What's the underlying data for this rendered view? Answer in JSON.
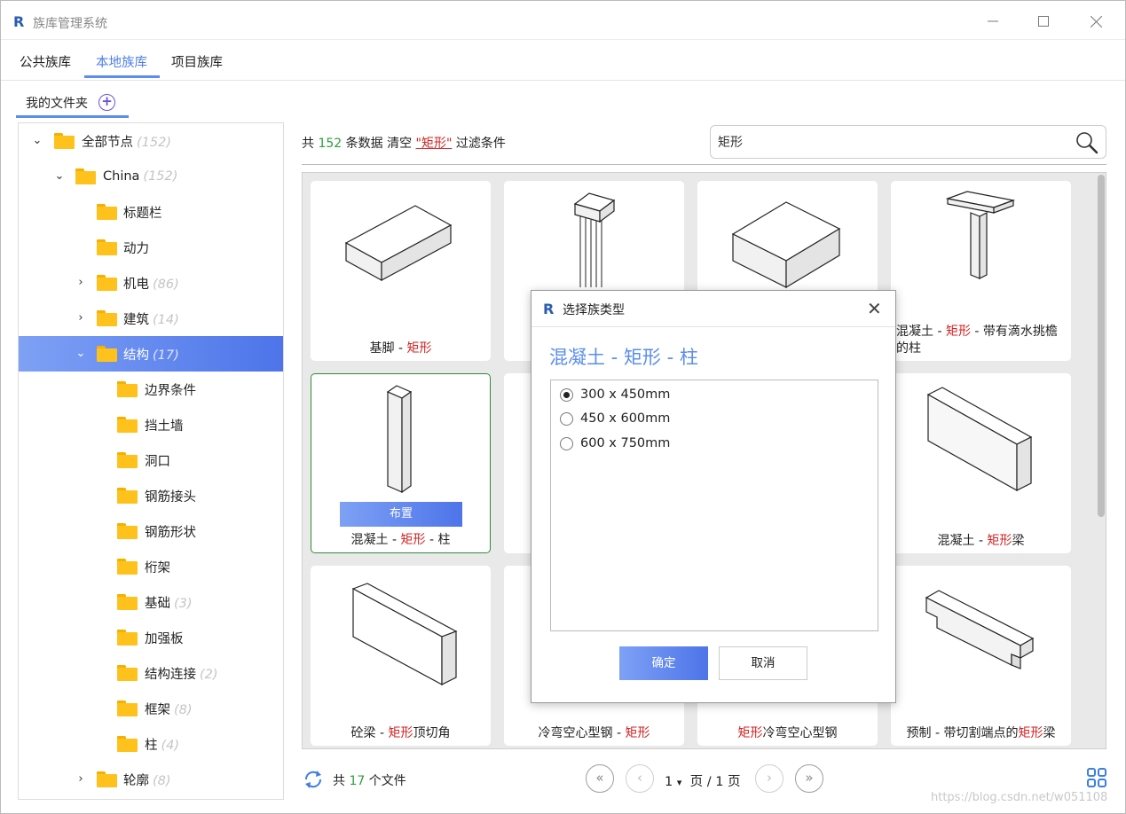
{
  "window": {
    "title": "族库管理系统",
    "app_icon": "revit-R-icon",
    "controls": [
      "minimize",
      "maximize",
      "close"
    ]
  },
  "tabs": [
    {
      "label": "公共族库",
      "active": false
    },
    {
      "label": "本地族库",
      "active": true
    },
    {
      "label": "项目族库",
      "active": false
    }
  ],
  "subtab": {
    "label": "我的文件夹",
    "add_icon": "plus-circle-icon"
  },
  "tree": [
    {
      "label": "全部节点",
      "count": "(152)",
      "expanded": true
    },
    {
      "label": "China",
      "count": "(152)",
      "expanded": true
    },
    {
      "label": "标题栏",
      "count": ""
    },
    {
      "label": "动力",
      "count": ""
    },
    {
      "label": "机电",
      "count": "(86)",
      "expanded": false
    },
    {
      "label": "建筑",
      "count": "(14)",
      "expanded": false
    },
    {
      "label": "结构",
      "count": "(17)",
      "expanded": true,
      "selected": true
    },
    {
      "label": "边界条件",
      "count": ""
    },
    {
      "label": "挡土墙",
      "count": ""
    },
    {
      "label": "洞口",
      "count": ""
    },
    {
      "label": "钢筋接头",
      "count": ""
    },
    {
      "label": "钢筋形状",
      "count": ""
    },
    {
      "label": "桁架",
      "count": ""
    },
    {
      "label": "基础",
      "count": "(3)"
    },
    {
      "label": "加强板",
      "count": ""
    },
    {
      "label": "结构连接",
      "count": "(2)"
    },
    {
      "label": "框架",
      "count": "(8)"
    },
    {
      "label": "柱",
      "count": "(4)"
    },
    {
      "label": "轮廓",
      "count": "(8)",
      "expanded": false
    }
  ],
  "info": {
    "prefix": "共",
    "count": "152",
    "suffix": "条数据",
    "clear": "清空",
    "filter": "\"矩形\"",
    "filter_suffix": "过滤条件"
  },
  "search": {
    "value": "矩形",
    "icon": "magnifier-icon"
  },
  "cards": [
    {
      "pre": "基脚 - ",
      "hl": "矩形",
      "post": ""
    },
    {
      "pre": "",
      "hl": "",
      "post": ""
    },
    {
      "pre": "",
      "hl": "",
      "post": ""
    },
    {
      "pre": "混凝土 - ",
      "hl": "矩形",
      "post": " - 带有滴水挑檐的柱"
    },
    {
      "pre": "混凝土 - ",
      "hl": "矩形",
      "post": " - 柱",
      "button": "布置"
    },
    {
      "pre": "",
      "hl": "",
      "post": ""
    },
    {
      "pre": "",
      "hl": "",
      "post": ""
    },
    {
      "pre": "混凝土 - ",
      "hl": "矩形",
      "post": "梁"
    },
    {
      "pre": "砼梁 - ",
      "hl": "矩形",
      "post": "顶切角"
    },
    {
      "pre": "冷弯空心型钢 - ",
      "hl": "矩形",
      "post": ""
    },
    {
      "pre": "",
      "hl": "矩形",
      "post": "冷弯空心型钢"
    },
    {
      "pre": "预制 - 带切割端点的",
      "hl": "矩形",
      "post": "梁"
    }
  ],
  "footer": {
    "prefix": "共",
    "count": "17",
    "suffix": "个文件",
    "page": "1",
    "page_text": "页 / 1 页",
    "first": "«",
    "prev": "‹",
    "next": "›",
    "last": "»",
    "caret": "▾"
  },
  "dialog": {
    "title": "选择族类型",
    "heading": "混凝土 - 矩形 - 柱",
    "options": [
      {
        "label": "300 x 450mm",
        "checked": true
      },
      {
        "label": "450 x 600mm",
        "checked": false
      },
      {
        "label": "600 x 750mm",
        "checked": false
      }
    ],
    "ok": "确定",
    "cancel": "取消"
  },
  "watermark": "https://blog.csdn.net/w051108",
  "colors": {
    "accent": "#5b8ded",
    "highlight": "#d42222",
    "count_green": "#2c9f3c",
    "folder": "#ffc21c"
  }
}
